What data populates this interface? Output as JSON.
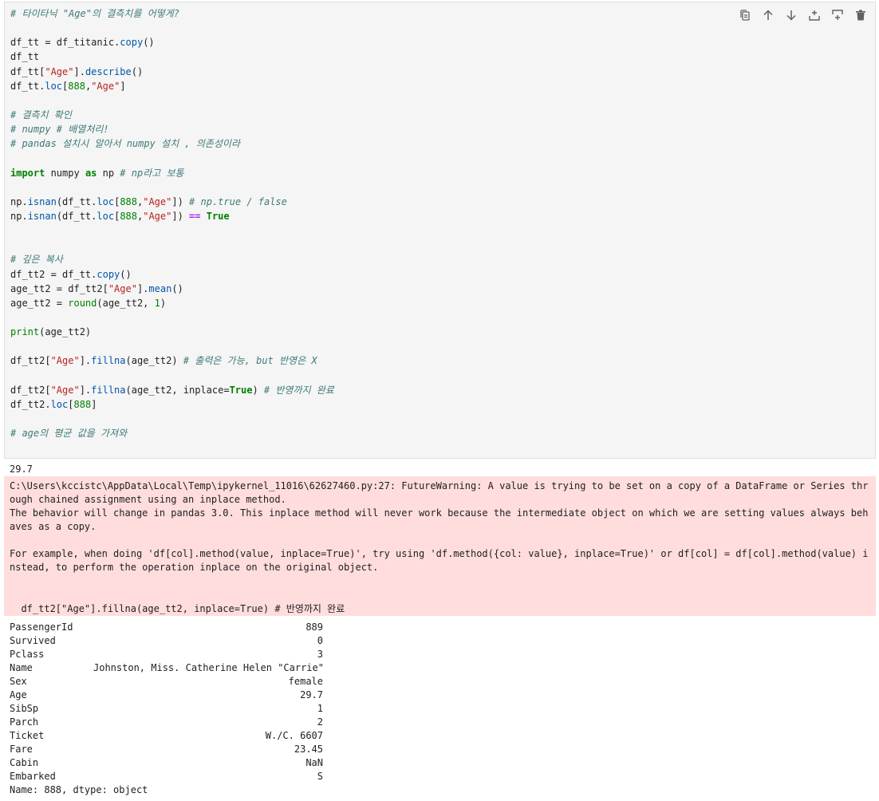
{
  "cell": {
    "toolbar": [
      {
        "name": "copy-cell-icon",
        "title": "복사"
      },
      {
        "name": "move-up-icon",
        "title": "위로"
      },
      {
        "name": "move-down-icon",
        "title": "아래로"
      },
      {
        "name": "insert-above-icon",
        "title": "위에 삽입"
      },
      {
        "name": "insert-below-icon",
        "title": "아래에 삽입"
      },
      {
        "name": "delete-cell-icon",
        "title": "삭제"
      }
    ],
    "code_lines": [
      [
        {
          "t": "cm",
          "v": "# 타이타닉 \"Age\"의 결측치를 어떻게?"
        }
      ],
      [],
      [
        {
          "t": "",
          "v": "df_tt = df_titanic."
        },
        {
          "t": "fn",
          "v": "copy"
        },
        {
          "t": "",
          "v": "()"
        }
      ],
      [
        {
          "t": "",
          "v": "df_tt"
        }
      ],
      [
        {
          "t": "",
          "v": "df_tt["
        },
        {
          "t": "st",
          "v": "\"Age\""
        },
        {
          "t": "",
          "v": "]."
        },
        {
          "t": "fn",
          "v": "describe"
        },
        {
          "t": "",
          "v": "()"
        }
      ],
      [
        {
          "t": "",
          "v": "df_tt."
        },
        {
          "t": "fn",
          "v": "loc"
        },
        {
          "t": "",
          "v": "["
        },
        {
          "t": "nm",
          "v": "888"
        },
        {
          "t": "",
          "v": ","
        },
        {
          "t": "st",
          "v": "\"Age\""
        },
        {
          "t": "",
          "v": "]"
        }
      ],
      [],
      [
        {
          "t": "cm",
          "v": "# 결측치 확인"
        }
      ],
      [
        {
          "t": "cm",
          "v": "# numpy # 배열처리!"
        }
      ],
      [
        {
          "t": "cm",
          "v": "# pandas 설치시 알아서 numpy 설치 , 의존성이라"
        }
      ],
      [],
      [
        {
          "t": "kw",
          "v": "import"
        },
        {
          "t": "",
          "v": " numpy "
        },
        {
          "t": "kw",
          "v": "as"
        },
        {
          "t": "",
          "v": " np "
        },
        {
          "t": "cm",
          "v": "# np라고 보통"
        }
      ],
      [],
      [
        {
          "t": "",
          "v": "np."
        },
        {
          "t": "fn",
          "v": "isnan"
        },
        {
          "t": "",
          "v": "(df_tt."
        },
        {
          "t": "fn",
          "v": "loc"
        },
        {
          "t": "",
          "v": "["
        },
        {
          "t": "nm",
          "v": "888"
        },
        {
          "t": "",
          "v": ","
        },
        {
          "t": "st",
          "v": "\"Age\""
        },
        {
          "t": "",
          "v": "]) "
        },
        {
          "t": "cm",
          "v": "# np.true / false"
        }
      ],
      [
        {
          "t": "",
          "v": "np."
        },
        {
          "t": "fn",
          "v": "isnan"
        },
        {
          "t": "",
          "v": "(df_tt."
        },
        {
          "t": "fn",
          "v": "loc"
        },
        {
          "t": "",
          "v": "["
        },
        {
          "t": "nm",
          "v": "888"
        },
        {
          "t": "",
          "v": ","
        },
        {
          "t": "st",
          "v": "\"Age\""
        },
        {
          "t": "",
          "v": "]) "
        },
        {
          "t": "op",
          "v": "=="
        },
        {
          "t": "",
          "v": " "
        },
        {
          "t": "kw",
          "v": "True"
        }
      ],
      [],
      [],
      [
        {
          "t": "cm",
          "v": "# 깊은 복사"
        }
      ],
      [
        {
          "t": "",
          "v": "df_tt2 = df_tt."
        },
        {
          "t": "fn",
          "v": "copy"
        },
        {
          "t": "",
          "v": "()"
        }
      ],
      [
        {
          "t": "",
          "v": "age_tt2 = df_tt2["
        },
        {
          "t": "st",
          "v": "\"Age\""
        },
        {
          "t": "",
          "v": "]."
        },
        {
          "t": "fn",
          "v": "mean"
        },
        {
          "t": "",
          "v": "()"
        }
      ],
      [
        {
          "t": "",
          "v": "age_tt2 = "
        },
        {
          "t": "bi",
          "v": "round"
        },
        {
          "t": "",
          "v": "(age_tt2, "
        },
        {
          "t": "nm",
          "v": "1"
        },
        {
          "t": "",
          "v": ")"
        }
      ],
      [],
      [
        {
          "t": "bi",
          "v": "print"
        },
        {
          "t": "",
          "v": "(age_tt2)"
        }
      ],
      [],
      [
        {
          "t": "",
          "v": "df_tt2["
        },
        {
          "t": "st",
          "v": "\"Age\""
        },
        {
          "t": "",
          "v": "]."
        },
        {
          "t": "fn",
          "v": "fillna"
        },
        {
          "t": "",
          "v": "(age_tt2) "
        },
        {
          "t": "cm",
          "v": "# 출력은 가능, but 반영은 X"
        }
      ],
      [],
      [
        {
          "t": "",
          "v": "df_tt2["
        },
        {
          "t": "st",
          "v": "\"Age\""
        },
        {
          "t": "",
          "v": "]."
        },
        {
          "t": "fn",
          "v": "fillna"
        },
        {
          "t": "",
          "v": "(age_tt2, inplace="
        },
        {
          "t": "kw",
          "v": "True"
        },
        {
          "t": "",
          "v": ") "
        },
        {
          "t": "cm",
          "v": "# 반영까지 완료"
        }
      ],
      [
        {
          "t": "",
          "v": "df_tt2."
        },
        {
          "t": "fn",
          "v": "loc"
        },
        {
          "t": "",
          "v": "["
        },
        {
          "t": "nm",
          "v": "888"
        },
        {
          "t": "",
          "v": "]"
        }
      ],
      [],
      [
        {
          "t": "cm",
          "v": "# age의 평균 값을 가져와"
        }
      ]
    ]
  },
  "output": {
    "print_value": "29.7",
    "warning_text": "C:\\Users\\kccistc\\AppData\\Local\\Temp\\ipykernel_11016\\62627460.py:27: FutureWarning: A value is trying to be set on a copy of a DataFrame or Series through chained assignment using an inplace method.\nThe behavior will change in pandas 3.0. This inplace method will never work because the intermediate object on which we are setting values always behaves as a copy.\n\nFor example, when doing 'df[col].method(value, inplace=True)', try using 'df.method({col: value}, inplace=True)' or df[col] = df[col].method(value) instead, to perform the operation inplace on the original object.",
    "warning_source": "  df_tt2[\"Age\"].fillna(age_tt2, inplace=True) # 반영까지 완료",
    "series_rows": [
      {
        "key": "PassengerId",
        "value": "889"
      },
      {
        "key": "Survived",
        "value": "0"
      },
      {
        "key": "Pclass",
        "value": "3"
      },
      {
        "key": "Name",
        "value": "Johnston, Miss. Catherine Helen \"Carrie\""
      },
      {
        "key": "Sex",
        "value": "female"
      },
      {
        "key": "Age",
        "value": "29.7"
      },
      {
        "key": "SibSp",
        "value": "1"
      },
      {
        "key": "Parch",
        "value": "2"
      },
      {
        "key": "Ticket",
        "value": "W./C. 6607"
      },
      {
        "key": "Fare",
        "value": "23.45"
      },
      {
        "key": "Cabin",
        "value": "NaN"
      },
      {
        "key": "Embarked",
        "value": "S"
      }
    ],
    "series_footer": "Name: 888, dtype: object"
  }
}
